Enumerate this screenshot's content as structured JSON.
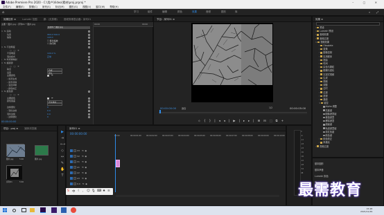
{
  "window": {
    "title": "Adobe Premiere Pro 2020 - C:\\用户\\Video\\素材\\proj.prproj *",
    "controls": [
      "–",
      "▢",
      "✕"
    ]
  },
  "menubar": [
    "文件(F)",
    "编辑(E)",
    "剪辑(C)",
    "序列(S)",
    "标记(M)",
    "图形(G)",
    "视图(V)",
    "窗口(W)",
    "帮助(H)"
  ],
  "workspaces": {
    "items": [
      "学习",
      "组件",
      "编辑",
      "颜色",
      "效果",
      "音频",
      "图形",
      "库"
    ],
    "active_index": 4
  },
  "effect_controls": {
    "tabs": [
      "效果控件 ≡",
      "Lumetri 范围",
      "源：(无剪辑)",
      "音频剪辑混合器：序列01"
    ],
    "active_tab": 0,
    "source_line": "主要 * 图片.jpg  ›  序列01 * 图片.jpg",
    "clip_name": "序列01 * 图片.jpg",
    "mini_ruler_left": "00:00",
    "mini_ruler_right": "00:00",
    "sections": [
      {
        "label": "fx 运动",
        "indent": 0,
        "toggle": "∨",
        "value": "",
        "kind": "header"
      },
      {
        "label": "位置",
        "indent": 1,
        "value": "960.0  540.0",
        "kind": "num"
      },
      {
        "label": "缩放",
        "indent": 1,
        "value": "100.0",
        "kind": "num"
      },
      {
        "label": "",
        "indent": 1,
        "value": "☐ 等比缩放",
        "kind": "text"
      },
      {
        "label": "",
        "indent": 1,
        "value": "☐ 防闪烁",
        "kind": "text"
      },
      {
        "label": "fx 不透明度",
        "indent": 0,
        "toggle": "∨",
        "value": "",
        "kind": "header"
      },
      {
        "label": "",
        "indent": 1,
        "value": "",
        "kind": "shapes"
      },
      {
        "label": "不透明度",
        "indent": 1,
        "value": "100.0 %",
        "kind": "num"
      },
      {
        "label": "混合模式",
        "indent": 1,
        "value": "正常",
        "kind": "num"
      },
      {
        "label": "fx 时间重映射",
        "indent": 0,
        "toggle": "›",
        "value": "",
        "kind": "header"
      },
      {
        "label": "fx 超级键",
        "indent": 0,
        "toggle": "∨",
        "value": "",
        "kind": "header"
      },
      {
        "label": "",
        "indent": 1,
        "value": "",
        "kind": "shapes"
      },
      {
        "label": "输出",
        "indent": 1,
        "value": "合成",
        "kind": "select"
      },
      {
        "label": "设置",
        "indent": 1,
        "value": "默认",
        "kind": "select"
      },
      {
        "label": "主要颜色",
        "indent": 1,
        "value": "",
        "kind": "swatch"
      },
      {
        "label": "› 遮罩生成",
        "indent": 1,
        "value": "",
        "kind": "plain"
      },
      {
        "label": "› 遮罩清除",
        "indent": 1,
        "value": "",
        "kind": "plain"
      },
      {
        "label": "› 溢出抑制",
        "indent": 1,
        "value": "",
        "kind": "plain"
      },
      {
        "label": "› 颜色校正",
        "indent": 1,
        "value": "",
        "kind": "plain"
      },
      {
        "label": "fx 颜色键",
        "indent": 0,
        "toggle": "∨",
        "value": "",
        "kind": "header"
      },
      {
        "label": "",
        "indent": 1,
        "value": "",
        "kind": "shapes"
      },
      {
        "label": "主要颜色",
        "indent": 1,
        "value": "",
        "kind": "swatch"
      },
      {
        "label": "颜色容差",
        "indent": 1,
        "value": "正片叠底",
        "kind": "select"
      },
      {
        "label": "",
        "indent": 1,
        "value": "",
        "kind": "select2"
      },
      {
        "label": "边缘细化",
        "indent": 1,
        "value": "0",
        "kind": "num"
      },
      {
        "label": "› 羽化边缘",
        "indent": 1,
        "value": "0.0",
        "kind": "num"
      },
      {
        "label": "羽化边缘",
        "indent": 1,
        "value": "0.0",
        "kind": "num"
      },
      {
        "label": "› 边缘细化",
        "indent": 1,
        "value": "0",
        "kind": "num"
      }
    ],
    "timecode": "00:00:00:00"
  },
  "program": {
    "title": "节目：序列01 ≡",
    "tc_left": "00:00:00:00",
    "fit": "适合",
    "fraction": "1/2",
    "tc_right": "00:00:05:00",
    "transport": [
      "⬦",
      "{",
      "}",
      "|◂",
      "◂|",
      "▶",
      "|▸",
      "▸|",
      "⊞",
      "⊟",
      "⬚",
      "⧉",
      "+"
    ]
  },
  "effects": {
    "title": "效果 ≡",
    "tree": [
      {
        "label": "预设",
        "level": 0,
        "type": "folder"
      },
      {
        "label": "Lumetri 预设",
        "level": 0,
        "type": "folder"
      },
      {
        "label": "音频效果",
        "level": 0,
        "type": "folder"
      },
      {
        "label": "音频过渡",
        "level": 0,
        "type": "folder"
      },
      {
        "label": "视频效果",
        "level": 0,
        "type": "folder",
        "open": true
      },
      {
        "label": "Obsolete",
        "level": 1,
        "type": "folder"
      },
      {
        "label": "变换",
        "level": 1,
        "type": "folder"
      },
      {
        "label": "图像控制",
        "level": 1,
        "type": "folder"
      },
      {
        "label": "实用程序",
        "level": 1,
        "type": "folder"
      },
      {
        "label": "扭曲",
        "level": 1,
        "type": "folder"
      },
      {
        "label": "时间",
        "level": 1,
        "type": "folder"
      },
      {
        "label": "杂色与颗粒",
        "level": 1,
        "type": "folder"
      },
      {
        "label": "模糊与锐化",
        "level": 1,
        "type": "folder"
      },
      {
        "label": "沉浸式视频",
        "level": 1,
        "type": "folder"
      },
      {
        "label": "生成",
        "level": 1,
        "type": "folder"
      },
      {
        "label": "视频",
        "level": 1,
        "type": "folder"
      },
      {
        "label": "调整",
        "level": 1,
        "type": "folder"
      },
      {
        "label": "过时",
        "level": 1,
        "type": "folder"
      },
      {
        "label": "过渡",
        "level": 1,
        "type": "folder"
      },
      {
        "label": "透视",
        "level": 1,
        "type": "folder"
      },
      {
        "label": "通道",
        "level": 1,
        "type": "folder"
      },
      {
        "label": "键控",
        "level": 1,
        "type": "folder",
        "open": true
      },
      {
        "label": "Alpha 调整",
        "level": 2,
        "type": "fx"
      },
      {
        "label": "亮度键",
        "level": 2,
        "type": "fx"
      },
      {
        "label": "图像遮罩键",
        "level": 2,
        "type": "fx"
      },
      {
        "label": "差值遮罩",
        "level": 2,
        "type": "fx"
      },
      {
        "label": "移除遮罩",
        "level": 2,
        "type": "fx"
      },
      {
        "label": "超级键",
        "level": 2,
        "type": "fx"
      },
      {
        "label": "轨道遮罩键",
        "level": 2,
        "type": "fx"
      },
      {
        "label": "非红色键",
        "level": 2,
        "type": "fx"
      },
      {
        "label": "颜色键",
        "level": 2,
        "type": "fx"
      },
      {
        "label": "颜色校正",
        "level": 1,
        "type": "folder"
      },
      {
        "label": "风格化",
        "level": 1,
        "type": "folder"
      },
      {
        "label": "视频过渡",
        "level": 0,
        "type": "folder"
      }
    ],
    "bottom_panels": [
      "基本图形",
      "基本声音",
      "Lumetri 颜色",
      "库",
      "标记"
    ]
  },
  "project": {
    "tabs": [
      "项目：proj ≡",
      "媒体浏览器"
    ],
    "items": [
      {
        "name": "图片.jpg",
        "dur": "5:00"
      },
      {
        "name": "图片.jpg",
        "dur": "5:00"
      },
      {
        "name": "序列01",
        "dur": "5:00"
      }
    ]
  },
  "timeline": {
    "title": "序列01 ≡",
    "timecode": "00:00:00:00",
    "ruler": [
      "00:00",
      "00:00:01:00",
      "00:00:02:00",
      "00:00:03:00",
      "00:00:04:00",
      "00:00:05:00",
      "00:00:06:00",
      "00:00:07:00",
      "00:00:08:00",
      "00:00:09:00",
      "00:00:10:00"
    ],
    "tracks": [
      {
        "name": "V3",
        "code": "V3"
      },
      {
        "name": "V2",
        "code": "V2"
      },
      {
        "name": "V1",
        "code": "V1"
      },
      {
        "name": "A1",
        "code": "A1"
      },
      {
        "name": "A2",
        "code": "A2"
      },
      {
        "name": "A3",
        "code": "A3"
      },
      {
        "name": "主声道",
        "code": "0.0"
      }
    ]
  },
  "audio_meter": {
    "ticks": [
      "0",
      "-6",
      "-12",
      "-18",
      "-24",
      "-30",
      "-36",
      "-42",
      "-48",
      "-54",
      "dB"
    ]
  },
  "watermark": "最需教育",
  "taskbar": {
    "time": "15:28",
    "date": "2021/11/29"
  },
  "colors": {
    "accent": "#2d8ceb",
    "clip": "#d887d8"
  }
}
